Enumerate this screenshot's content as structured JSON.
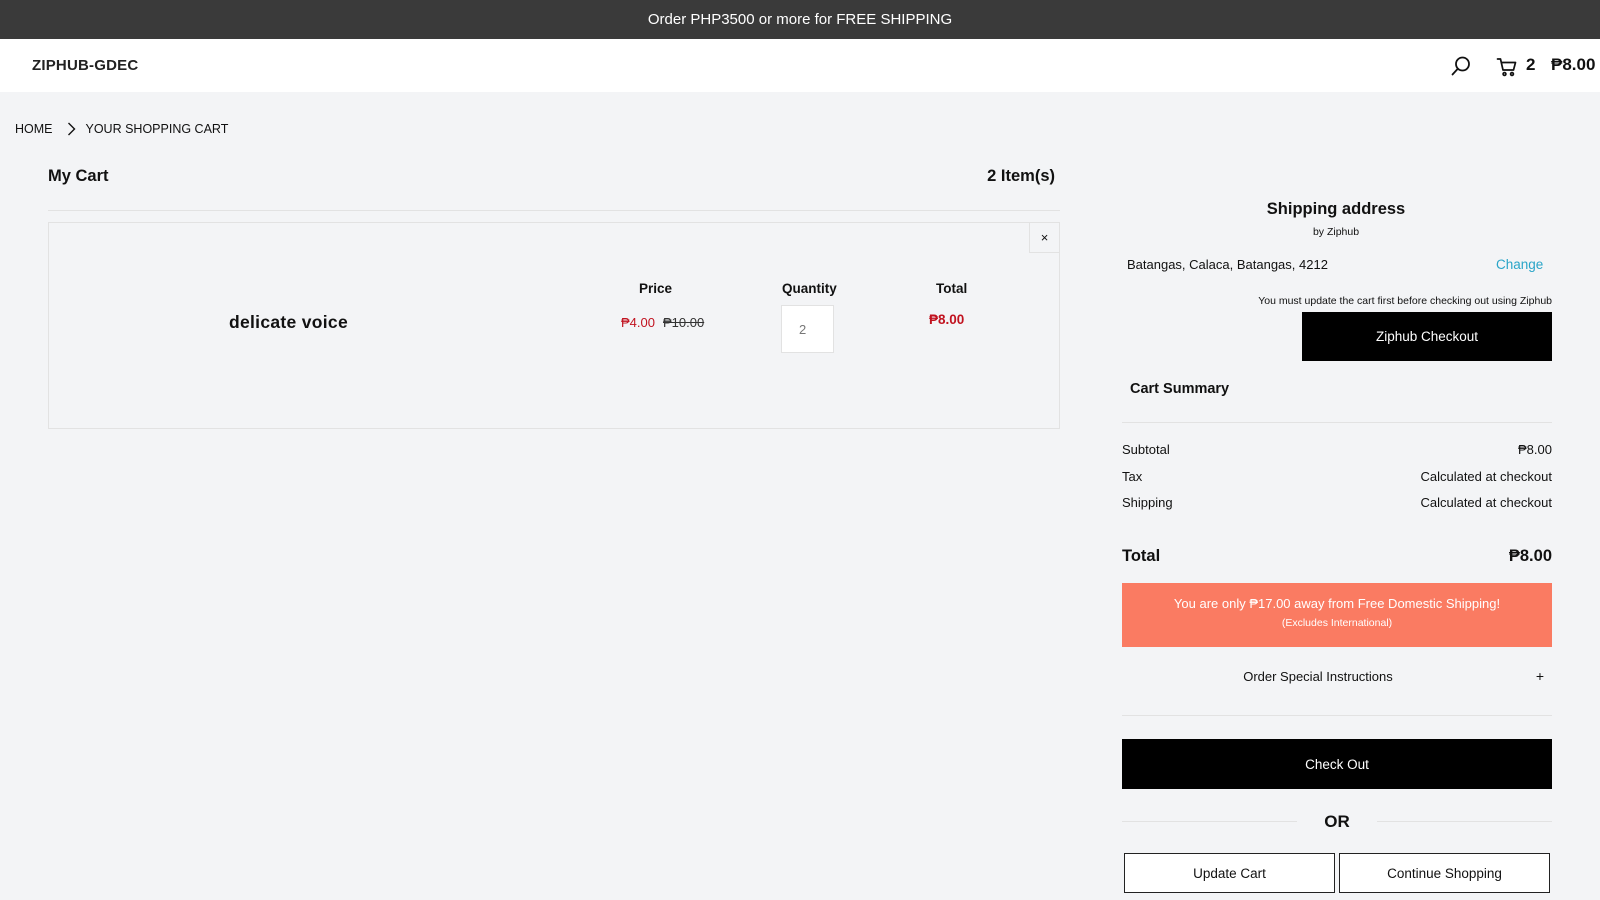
{
  "announcement": "Order PHP3500 or more for FREE SHIPPING",
  "header": {
    "logo": "ZIPHUB-GDEC",
    "cart_count": "2",
    "cart_total": "₱8.00",
    "icons": [
      "search-icon",
      "cart-icon"
    ]
  },
  "breadcrumb": {
    "home": "HOME",
    "current": "YOUR SHOPPING CART"
  },
  "cart": {
    "title": "My Cart",
    "items_count": "2 Item(s)",
    "remove_label": "×",
    "columns": {
      "price": "Price",
      "quantity": "Quantity",
      "total": "Total"
    },
    "item": {
      "name": "delicate voice",
      "price": "₱4.00",
      "compare_price": "₱10.00",
      "quantity": "2",
      "total": "₱8.00"
    }
  },
  "shipping": {
    "title": "Shipping address",
    "by": "by Ziphub",
    "address": "Batangas, Calaca, Batangas, 4212",
    "change_label": "Change",
    "note": "You must update the cart first before checking out using Ziphub",
    "ziphub_checkout_label": "Ziphub Checkout"
  },
  "summary": {
    "title": "Cart Summary",
    "subtotal_label": "Subtotal",
    "subtotal_value": "₱8.00",
    "tax_label": "Tax",
    "tax_value": "Calculated at checkout",
    "shipping_label": "Shipping",
    "shipping_value": "Calculated at checkout",
    "total_label": "Total",
    "total_value": "₱8.00"
  },
  "free_shipping": {
    "message": "You are only ₱17.00 away from Free Domestic Shipping!",
    "note": "(Excludes International)"
  },
  "instructions": {
    "label": "Order Special Instructions",
    "toggle": "+"
  },
  "actions": {
    "checkout_label": "Check Out",
    "or_label": "OR",
    "update_cart_label": "Update Cart",
    "continue_shopping_label": "Continue Shopping"
  },
  "colors": {
    "announcement_bg": "#3a3a3a",
    "sale_price": "#c1121f",
    "link": "#2aa5c8",
    "free_shipping_bg": "#fa7b62",
    "button_bg": "#000000"
  }
}
